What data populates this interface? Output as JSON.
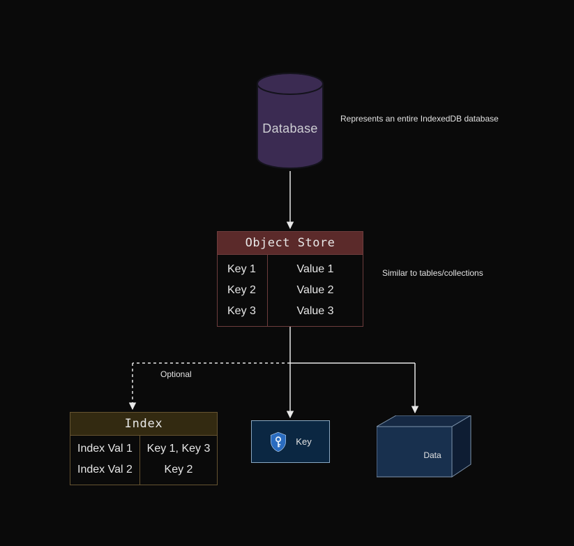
{
  "database": {
    "title": "Database",
    "description": "Represents an entire IndexedDB database"
  },
  "object_store": {
    "title": "Object Store",
    "description": "Similar to tables/collections",
    "rows": [
      {
        "key": "Key 1",
        "value": "Value 1"
      },
      {
        "key": "Key 2",
        "value": "Value 2"
      },
      {
        "key": "Key 3",
        "value": "Value 3"
      }
    ]
  },
  "arrow_optional_label": "Optional",
  "index": {
    "title": "Index",
    "rows": [
      {
        "key": "Index Val 1",
        "value": "Key 1, Key 3"
      },
      {
        "key": "Index Val 2",
        "value": "Key 2"
      }
    ]
  },
  "key_node": {
    "label": "Key"
  },
  "data_node": {
    "label": "Data"
  }
}
